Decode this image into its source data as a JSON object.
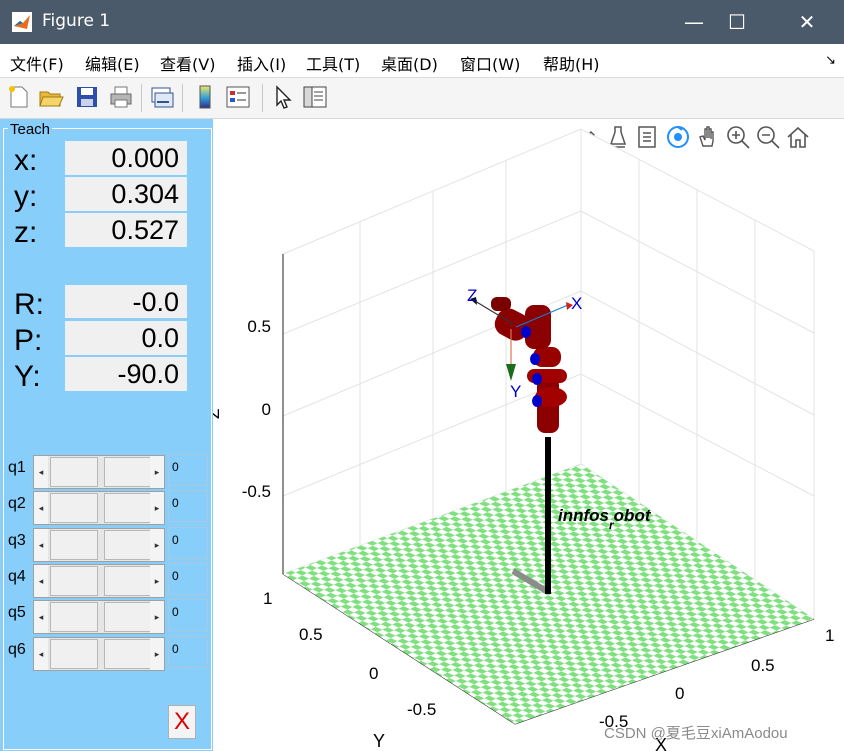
{
  "window": {
    "title": "Figure 1",
    "minimize": "—",
    "maximize": "☐",
    "close": "✕"
  },
  "menu": {
    "items": [
      "文件(F)",
      "编辑(E)",
      "查看(V)",
      "插入(I)",
      "工具(T)",
      "桌面(D)",
      "窗口(W)",
      "帮助(H)"
    ],
    "dock_arrow": "↘"
  },
  "toolbar": {
    "icons": [
      "new-figure-icon",
      "open-file-icon",
      "save-icon",
      "print-icon",
      "link-plot-icon",
      "insert-colorbar-icon",
      "insert-legend-icon",
      "select-pointer-icon",
      "property-inspector-icon"
    ]
  },
  "teach": {
    "title": "Teach",
    "x_label": "x:",
    "x_value": "0.000",
    "y_label": "y:",
    "y_value": "0.304",
    "z_label": "z:",
    "z_value": "0.527",
    "R_label": "R:",
    "R_value": "-0.0",
    "P_label": "P:",
    "P_value": "0.0",
    "Y_label": "Y:",
    "Y_value": "-90.0",
    "joints": [
      {
        "name": "q1",
        "value": "0"
      },
      {
        "name": "q2",
        "value": "0"
      },
      {
        "name": "q3",
        "value": "0"
      },
      {
        "name": "q4",
        "value": "0"
      },
      {
        "name": "q5",
        "value": "0"
      },
      {
        "name": "q6",
        "value": "0"
      }
    ],
    "close_label": "X"
  },
  "axes_toolbar": {
    "icons": [
      "brush-icon",
      "data-cursor-icon",
      "legend-icon",
      "rotate-3d-icon",
      "pan-icon",
      "zoom-in-icon",
      "zoom-out-icon",
      "home-icon"
    ]
  },
  "plot": {
    "robot_name": "innfos",
    "robot_name_sub": "r",
    "robot_name_tail": "obot",
    "z_label": "Z",
    "y_label": "Y",
    "x_label": "X",
    "z_ticks": [
      "0.5",
      "0",
      "-0.5"
    ],
    "y_ticks": [
      "1",
      "0.5",
      "0",
      "-0.5"
    ],
    "x_ticks": [
      "1",
      "0.5",
      "0",
      "-0.5"
    ],
    "frame_labels": {
      "x": "X",
      "y": "Y",
      "z": "Z"
    }
  },
  "watermark": "CSDN @夏毛豆xiAmAodou",
  "colors": {
    "panel": "#87cefa",
    "titlebar": "#4a5a6a",
    "floor_green": "#7fe07f",
    "link_red": "#8b0000",
    "joint_blue": "#0000cd"
  }
}
